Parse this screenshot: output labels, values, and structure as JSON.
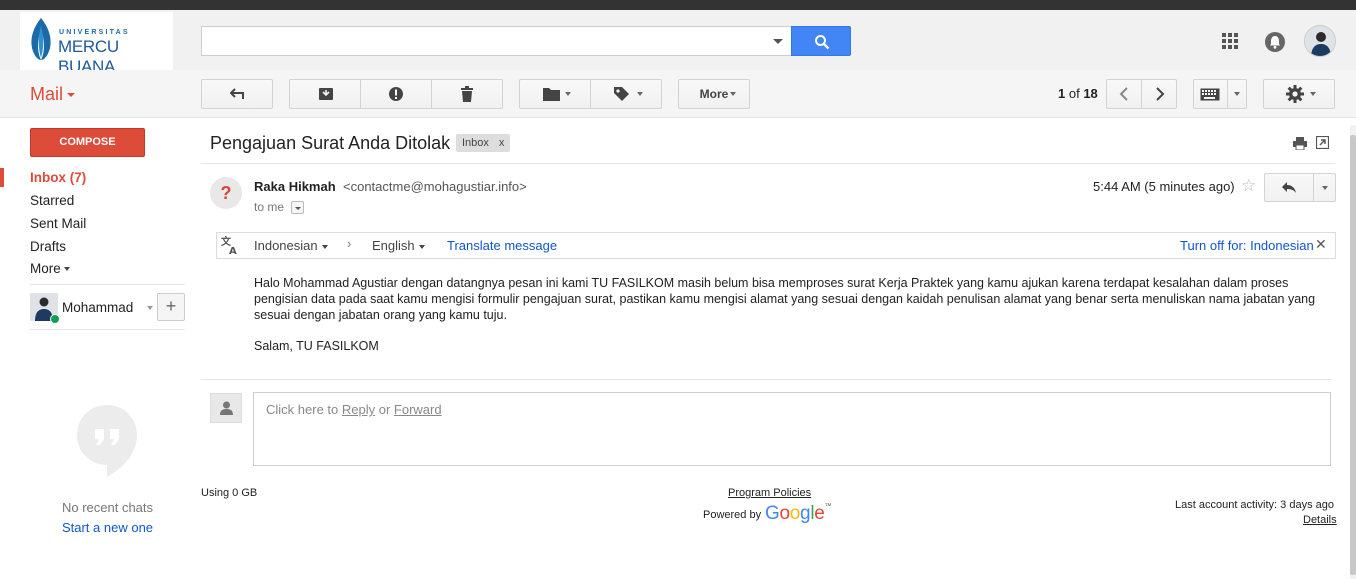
{
  "header": {
    "logo_top": "UNIVERSITAS",
    "logo_main": "MERCU BUANA",
    "search_value": "",
    "icons": [
      "apps-grid-icon",
      "notifications-icon",
      "account-avatar"
    ]
  },
  "toolbar": {
    "app_label": "Mail",
    "more_label": "More",
    "pager_current": "1",
    "pager_of": " of ",
    "pager_total": "18"
  },
  "sidebar": {
    "compose_label": "COMPOSE",
    "items": [
      {
        "label": "Inbox (7)",
        "selected": true
      },
      {
        "label": "Starred"
      },
      {
        "label": "Sent Mail"
      },
      {
        "label": "Drafts"
      },
      {
        "label": "More"
      }
    ],
    "hangouts_name": "Mohammad",
    "hangouts_add": "+",
    "no_recent": "No recent chats",
    "start_new": "Start a new one"
  },
  "message": {
    "subject": "Pengajuan Surat Anda Ditolak",
    "tag": "Inbox",
    "tag_close": "x",
    "sender_initial": "?",
    "sender_name": "Raka Hikmah",
    "sender_email": "<contactme@mohagustiar.info>",
    "to": "to me",
    "time": "5:44 AM (5 minutes ago)",
    "star": "☆",
    "body": "Halo Mohammad Agustiar dengan datangnya pesan ini kami TU FASILKOM masih belum bisa memproses surat Kerja Praktek yang kamu ajukan karena terdapat kesalahan dalam proses pengisian data pada saat kamu mengisi formulir pengajuan surat, pastikan kamu mengisi alamat yang sesuai dengan kaidah penulisan alamat yang benar serta menuliskan nama jabatan yang sesuai dengan jabatan orang yang kamu tuju.",
    "signature": "Salam, TU FASILKOM"
  },
  "translate": {
    "from": "Indonesian",
    "arrow": "›",
    "to": "English",
    "link": "Translate message",
    "turn_off": "Turn off for: Indonesian",
    "close": "✕"
  },
  "reply": {
    "prefix": "Click here to ",
    "reply_link": "Reply",
    "or": " or ",
    "forward_link": "Forward"
  },
  "footer": {
    "usage": "Using 0 GB",
    "policies": "Program Policies",
    "powered": "Powered by",
    "last_activity": "Last account activity: 3 days ago",
    "details": "Details"
  },
  "colors": {
    "accent_red": "#dd4b39",
    "search_blue": "#4285f4",
    "link_blue": "#1155cc"
  }
}
